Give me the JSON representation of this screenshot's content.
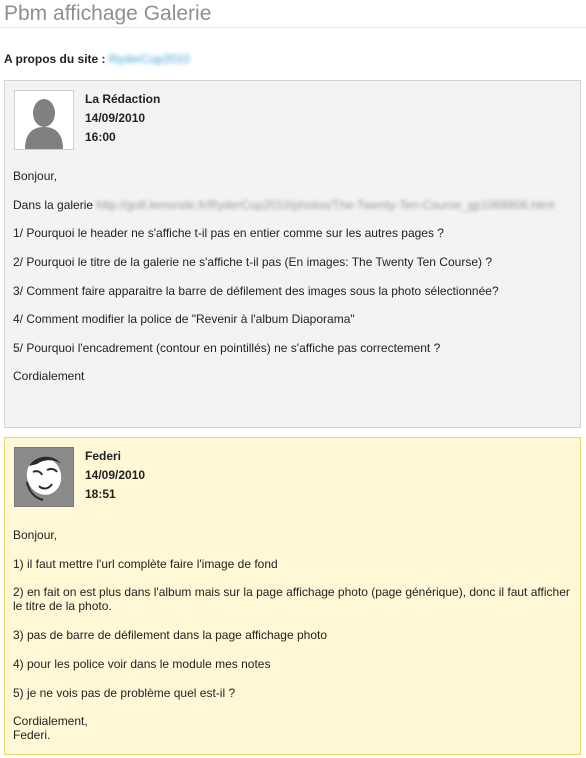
{
  "page": {
    "title": "Pbm affichage Galerie",
    "about_label": "A propos du site :",
    "about_link": "RyderCup2010"
  },
  "posts": [
    {
      "author": "La Rédaction",
      "date": "14/09/2010",
      "time": "16:00",
      "greeting": "Bonjour,",
      "gallery_intro": "Dans la galerie",
      "gallery_url": "http://golf.lemonde.fr/RyderCup2010/photos/The-Twenty-Ten-Course_gp1068806.html",
      "lines": [
        "1/ Pourquoi le header ne s'affiche t-il pas en entier comme sur les autres pages ?",
        "2/ Pourquoi le titre de la galerie ne s'affiche t-il pas (En images: The Twenty Ten Course) ?",
        "3/ Comment faire apparaitre la barre de défilement des images sous la photo sélectionnée?",
        "4/ Comment modifier la police de \"Revenir à l'album Diaporama\"",
        "5/ Pourquoi l'encadrement (contour en pointillés) ne s'affiche pas correctement ?"
      ],
      "closing": "Cordialement"
    },
    {
      "author": "Federi",
      "date": "14/09/2010",
      "time": "18:51",
      "greeting": "Bonjour,",
      "lines": [
        "1) il faut mettre l'url complète faire l'image de fond",
        "2) en fait on est plus dans l'album mais sur la page affichage photo (page générique), donc il faut afficher le titre de la photo.",
        "3) pas de barre de défilement dans la page affichage photo",
        "4) pour les police voir dans le module mes notes",
        "5) je ne vois pas de problème quel est-il ?"
      ],
      "closing": "Cordialement,",
      "signature": "Federi."
    }
  ]
}
